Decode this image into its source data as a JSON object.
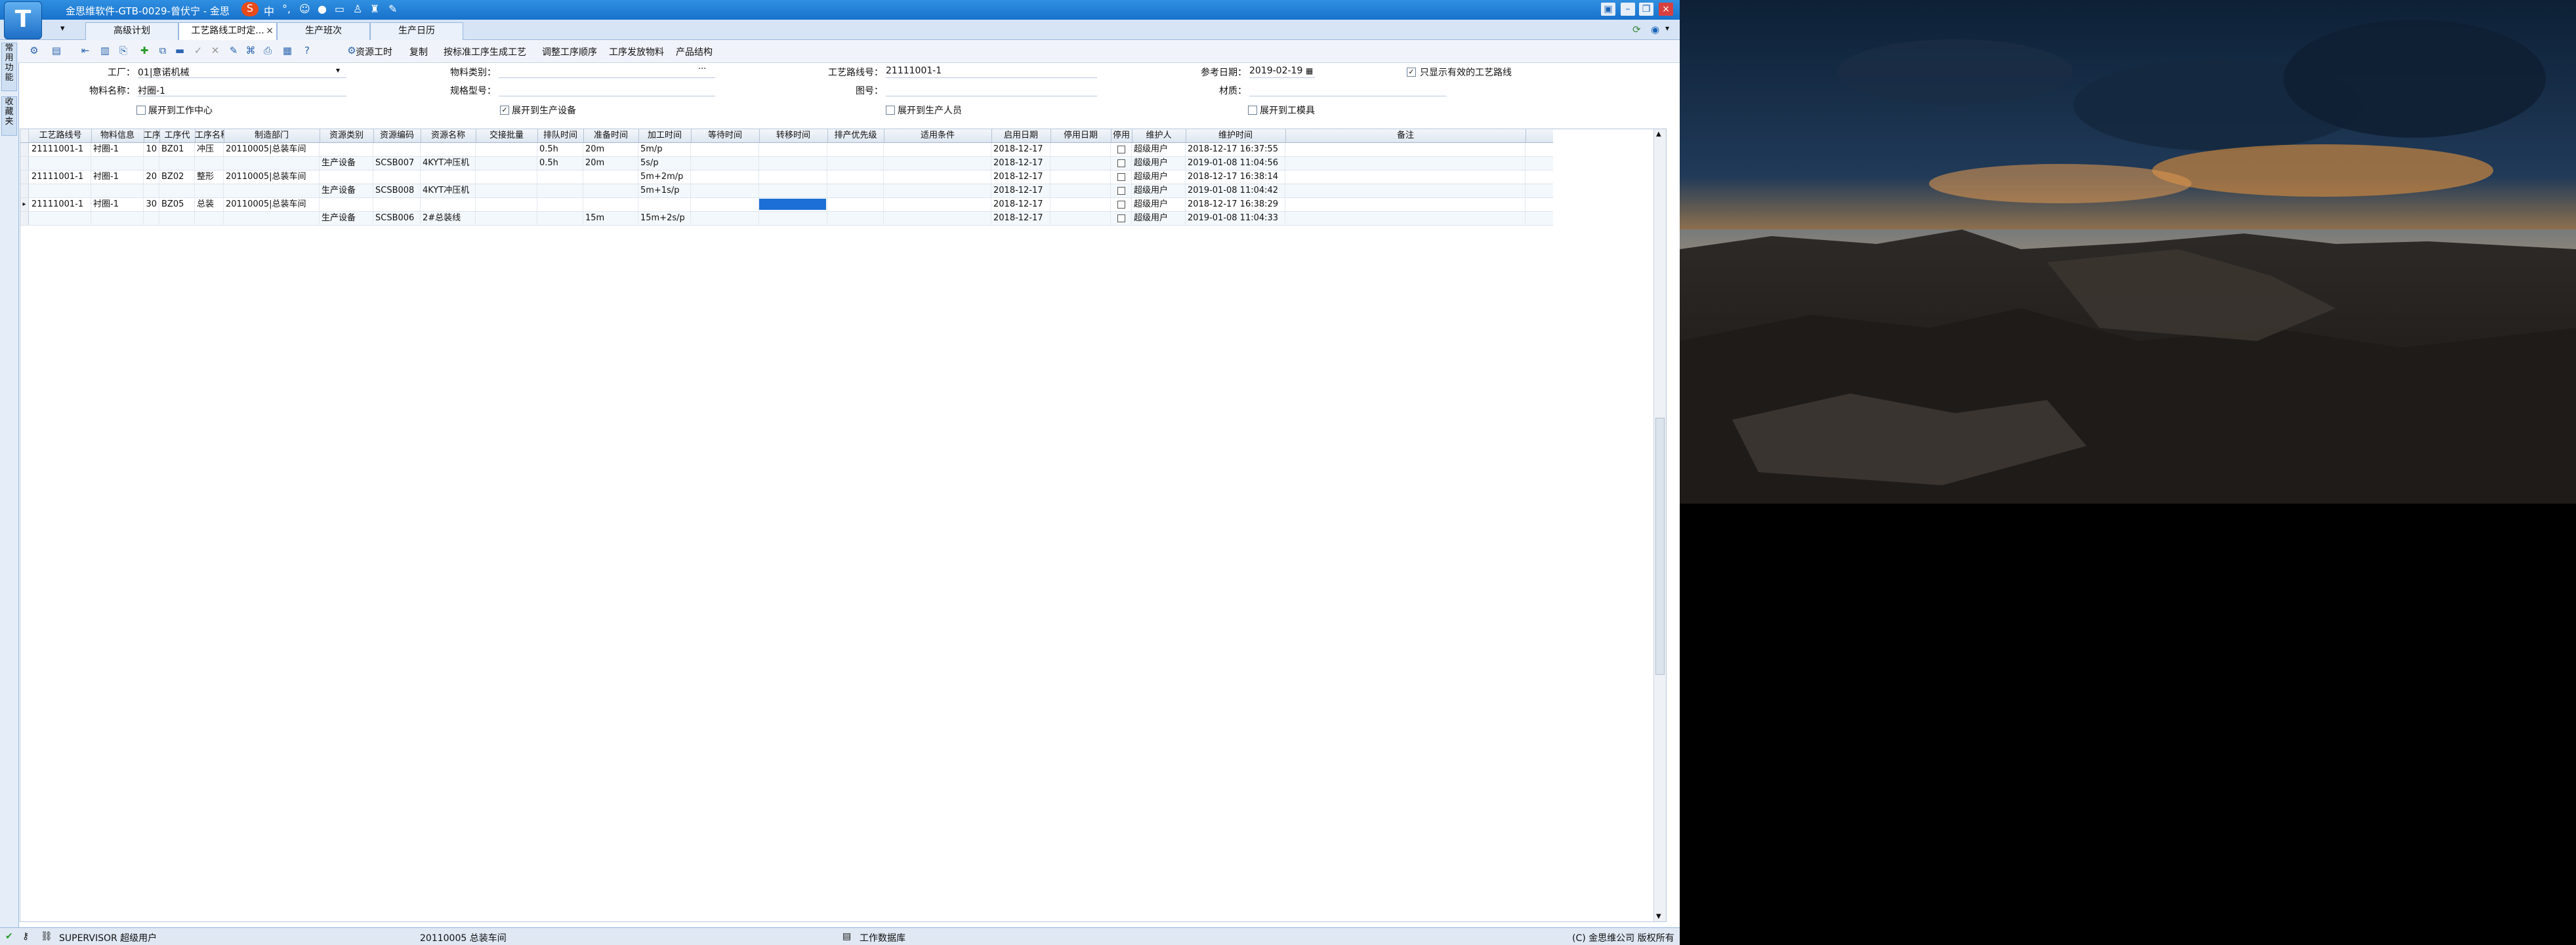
{
  "window": {
    "title": "金思维软件-GTB-0029-曾伏宁 - 金思",
    "tray_icons": [
      "sogou-s-icon",
      "chinese-mode-icon",
      "punctuation-icon",
      "emoji-icon",
      "microphone-icon",
      "keyboard-icon",
      "user-icon",
      "shirt-icon",
      "wrench-icon"
    ],
    "tray_text": "中"
  },
  "tabs": [
    {
      "label": "高级计划",
      "active": false
    },
    {
      "label": "工艺路线工时定...",
      "active": true
    },
    {
      "label": "生产班次",
      "active": false
    },
    {
      "label": "生产日历",
      "active": false
    }
  ],
  "toolbar": {
    "items": [
      "资源工时",
      "复制",
      "按标准工序生成工艺",
      "调整工序顺序",
      "工序发放物料",
      "产品结构"
    ]
  },
  "leftdock": {
    "tabs": [
      "常用功能",
      "收藏夹"
    ]
  },
  "filters": {
    "factory_label": "工厂：",
    "factory_value": "01|意诺机械",
    "material_type_label": "物料类别：",
    "material_type_value": "",
    "route_no_label": "工艺路线号：",
    "route_no_value": "21111001-1",
    "ref_date_label": "参考日期：",
    "ref_date_value": "2019-02-19",
    "only_valid_label": "只显示有效的工艺路线",
    "material_name_label": "物料名称：",
    "material_name_value": "衬圈-1",
    "spec_label": "规格型号：",
    "spec_value": "",
    "drawing_label": "图号：",
    "drawing_value": "",
    "material_label": "材质：",
    "material_value": "",
    "expand_work_center": "展开到工作中心",
    "expand_equipment": "展开到生产设备",
    "expand_personnel": "展开到生产人员",
    "expand_mold": "展开到工模具"
  },
  "grid": {
    "columns": [
      "工艺路线号",
      "物料信息",
      "工序号",
      "工序代",
      "工序名称",
      "制造部门",
      "资源类别",
      "资源编码",
      "资源名称",
      "交接批量",
      "排队时间",
      "准备时间",
      "加工时间",
      "等待时间",
      "转移时间",
      "排产优先级",
      "适用条件",
      "启用日期",
      "停用日期",
      "停用",
      "维护人",
      "维护时间",
      "备注"
    ],
    "rows": [
      [
        "21111001-1",
        "衬圈-1",
        "10",
        "BZ01",
        "冲压",
        "20110005|总装车间",
        "",
        "",
        "",
        "",
        "0.5h",
        "20m",
        "5m/p",
        "",
        "",
        "",
        "",
        "2018-12-17",
        "",
        "",
        "超级用户",
        "2018-12-17 16:37:55",
        ""
      ],
      [
        "",
        "",
        "",
        "",
        "",
        "",
        "生产设备",
        "SCSB007",
        "4KYT冲压机",
        "",
        "0.5h",
        "20m",
        "5s/p",
        "",
        "",
        "",
        "",
        "2018-12-17",
        "",
        "",
        "超级用户",
        "2019-01-08 11:04:56",
        ""
      ],
      [
        "21111001-1",
        "衬圈-1",
        "20",
        "BZ02",
        "整形",
        "20110005|总装车间",
        "",
        "",
        "",
        "",
        "",
        "",
        "5m+2m/p",
        "",
        "",
        "",
        "",
        "2018-12-17",
        "",
        "",
        "超级用户",
        "2018-12-17 16:38:14",
        ""
      ],
      [
        "",
        "",
        "",
        "",
        "",
        "",
        "生产设备",
        "SCSB008",
        "4KYT冲压机",
        "",
        "",
        "",
        "5m+1s/p",
        "",
        "",
        "",
        "",
        "2018-12-17",
        "",
        "",
        "超级用户",
        "2019-01-08 11:04:42",
        ""
      ],
      [
        "21111001-1",
        "衬圈-1",
        "30",
        "BZ05",
        "总装",
        "20110005|总装车间",
        "",
        "",
        "",
        "",
        "",
        "",
        "",
        "",
        "",
        "",
        "",
        "2018-12-17",
        "",
        "",
        "超级用户",
        "2018-12-17 16:38:29",
        ""
      ],
      [
        "",
        "",
        "",
        "",
        "",
        "",
        "生产设备",
        "SCSB006",
        "2#总装线",
        "",
        "",
        "15m",
        "15m+2s/p",
        "",
        "",
        "",
        "",
        "2018-12-17",
        "",
        "",
        "超级用户",
        "2019-01-08 11:04:33",
        ""
      ]
    ]
  },
  "statusbar": {
    "user": "SUPERVISOR 超级用户",
    "department": "20110005 总装车间",
    "database": "工作数据库",
    "copyright": "(C) 金思维公司 版权所有"
  },
  "colors": {
    "titlebar": "#1872cc",
    "selection": "#1b6fd6"
  }
}
